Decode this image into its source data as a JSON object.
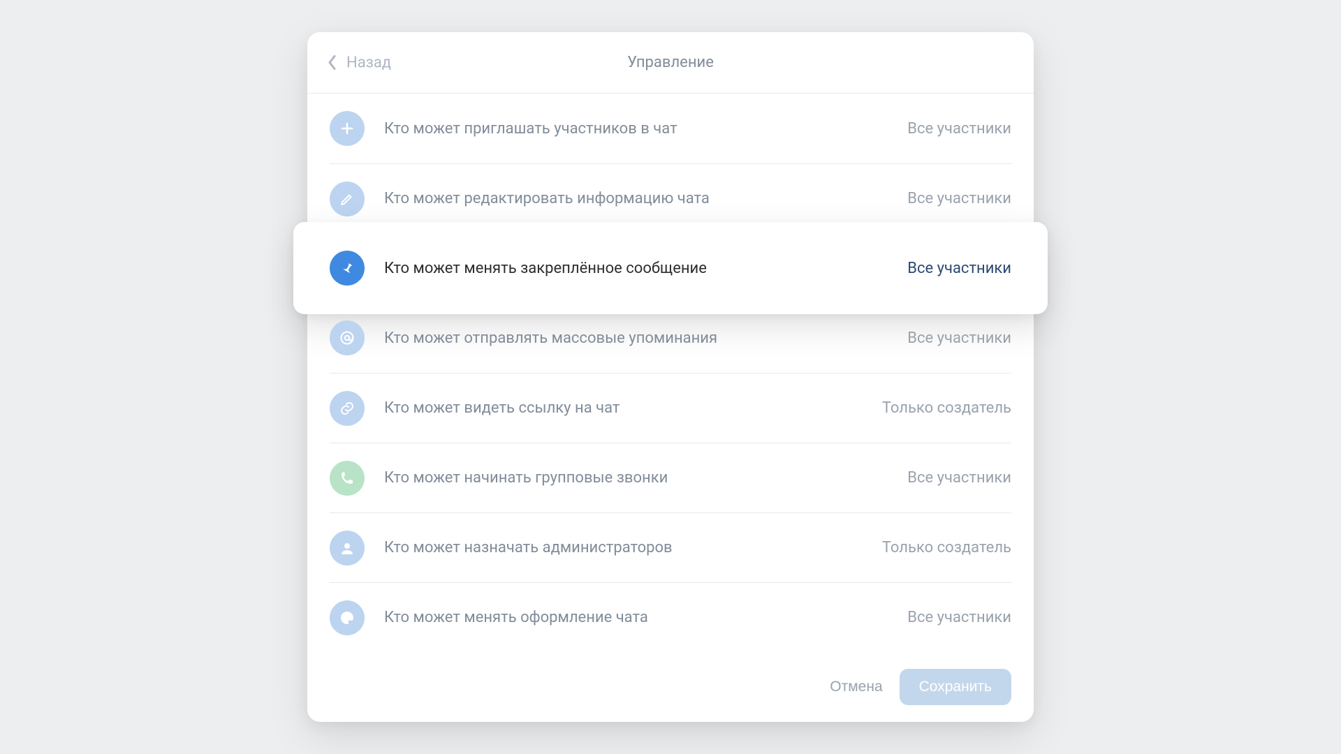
{
  "header": {
    "back": "Назад",
    "title": "Управление"
  },
  "rows": [
    {
      "icon": "plus",
      "iconColor": "blue",
      "label": "Кто может приглашать участников в чат",
      "value": "Все участники",
      "active": false
    },
    {
      "icon": "pencil",
      "iconColor": "blue",
      "label": "Кто может редактировать информацию чата",
      "value": "Все участники",
      "active": false
    },
    {
      "icon": "pin",
      "iconColor": "blue",
      "label": "Кто может менять закреплённое сообщение",
      "value": "Все участники",
      "active": true
    },
    {
      "icon": "at",
      "iconColor": "blue",
      "label": "Кто может отправлять массовые упоминания",
      "value": "Все участники",
      "active": false
    },
    {
      "icon": "link",
      "iconColor": "blue",
      "label": "Кто может видеть ссылку на чат",
      "value": "Только создатель",
      "active": false
    },
    {
      "icon": "phone",
      "iconColor": "green",
      "label": "Кто может начинать групповые звонки",
      "value": "Все участники",
      "active": false
    },
    {
      "icon": "user",
      "iconColor": "blue",
      "label": "Кто может назначать администраторов",
      "value": "Только создатель",
      "active": false
    },
    {
      "icon": "palette",
      "iconColor": "blue",
      "label": "Кто может менять оформление чата",
      "value": "Все участники",
      "active": false
    }
  ],
  "footer": {
    "cancel": "Отмена",
    "save": "Сохранить"
  }
}
